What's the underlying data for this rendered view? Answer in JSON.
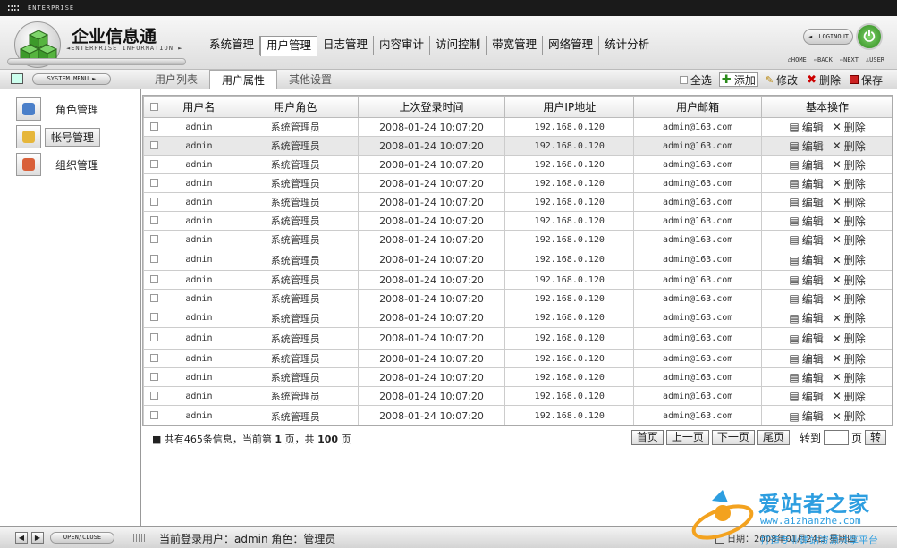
{
  "topbar": {
    "brand": "ENTERPRISE"
  },
  "header": {
    "title": "企业信息通",
    "subtitle": "◄ENTERPRISE INFORMATION ►",
    "logout": "LOGINOUT",
    "nav": [
      "系统管理",
      "用户管理",
      "日志管理",
      "内容审计",
      "访问控制",
      "带宽管理",
      "网络管理",
      "统计分析"
    ],
    "active_nav": 1
  },
  "quicklinks": {
    "home": "HOME",
    "back": "BACK",
    "next": "NEXT",
    "user": "USER"
  },
  "sysmenu": {
    "label": "SYSTEM MENU ►"
  },
  "subtabs": [
    "用户列表",
    "用户属性",
    "其他设置"
  ],
  "active_subtab": 1,
  "toolbar": {
    "select_all": "全选",
    "add": "添加",
    "edit": "修改",
    "delete": "删除",
    "save": "保存"
  },
  "sidebar": {
    "items": [
      {
        "label": "角色管理",
        "icon": "role-icon",
        "color": "#4a7fc9"
      },
      {
        "label": "帐号管理",
        "icon": "account-icon",
        "color": "#e6b63a"
      },
      {
        "label": "组织管理",
        "icon": "org-icon",
        "color": "#d9603a"
      }
    ],
    "active": 1
  },
  "table": {
    "headers": [
      "用户名",
      "用户角色",
      "上次登录时间",
      "用户IP地址",
      "用户邮箱",
      "基本操作"
    ],
    "op_edit": "编辑",
    "op_delete": "删除",
    "selected_row": 1,
    "rows": [
      [
        "admin",
        "系统管理员",
        "2008-01-24 10:07:20",
        "192.168.0.120",
        "admin@163.com"
      ],
      [
        "admin",
        "系统管理员",
        "2008-01-24 10:07:20",
        "192.168.0.120",
        "admin@163.com"
      ],
      [
        "admin",
        "系统管理员",
        "2008-01-24 10:07:20",
        "192.168.0.120",
        "admin@163.com"
      ],
      [
        "admin",
        "系统管理员",
        "2008-01-24 10:07:20",
        "192.168.0.120",
        "admin@163.com"
      ],
      [
        "admin",
        "系统管理员",
        "2008-01-24 10:07:20",
        "192.168.0.120",
        "admin@163.com"
      ],
      [
        "admin",
        "系统管理员",
        "2008-01-24 10:07:20",
        "192.168.0.120",
        "admin@163.com"
      ],
      [
        "admin",
        "系统管理员",
        "2008-01-24 10:07:20",
        "192.168.0.120",
        "admin@163.com"
      ],
      [
        "admin",
        "系统管理员",
        "2008-01-24 10:07:20",
        "192.168.0.120",
        "admin@163.com"
      ],
      [
        "admin",
        "系统管理员",
        "2008-01-24 10:07:20",
        "192.168.0.120",
        "admin@163.com"
      ],
      [
        "admin",
        "系统管理员",
        "2008-01-24 10:07:20",
        "192.168.0.120",
        "admin@163.com"
      ],
      [
        "admin",
        "系统管理员",
        "2008-01-24 10:07:20",
        "192.168.0.120",
        "admin@163.com"
      ],
      [
        "admin",
        "系统管理员",
        "2008-01-24 10:07:20",
        "192.168.0.120",
        "admin@163.com"
      ],
      [
        "admin",
        "系统管理员",
        "2008-01-24 10:07:20",
        "192.168.0.120",
        "admin@163.com"
      ],
      [
        "admin",
        "系统管理员",
        "2008-01-24 10:07:20",
        "192.168.0.120",
        "admin@163.com"
      ],
      [
        "admin",
        "系统管理员",
        "2008-01-24 10:07:20",
        "192.168.0.120",
        "admin@163.com"
      ],
      [
        "admin",
        "系统管理员",
        "2008-01-24 10:07:20",
        "192.168.0.120",
        "admin@163.com"
      ]
    ]
  },
  "pager": {
    "info_prefix": "共有465条信息，当前第",
    "current": "1",
    "info_mid": "页，共",
    "total": "100",
    "info_suffix": "页",
    "first": "首页",
    "prev": "上一页",
    "next": "下一页",
    "last": "尾页",
    "goto": "转到",
    "page_unit": "页",
    "go": "转"
  },
  "footer": {
    "openclose": "OPEN/CLOSE",
    "current_user": "当前登录用户：admin 角色：管理员",
    "date": "日期：2008年01月24日 星期四"
  },
  "watermark": {
    "title": "爱站者之家",
    "url": "www.aizhanzhe.com",
    "slogan": "打造专业建站资源共享平台"
  },
  "colors": {
    "accent_green": "#2f8a1f",
    "watermark_blue": "#2d9ee0",
    "delete_red": "#c00"
  }
}
